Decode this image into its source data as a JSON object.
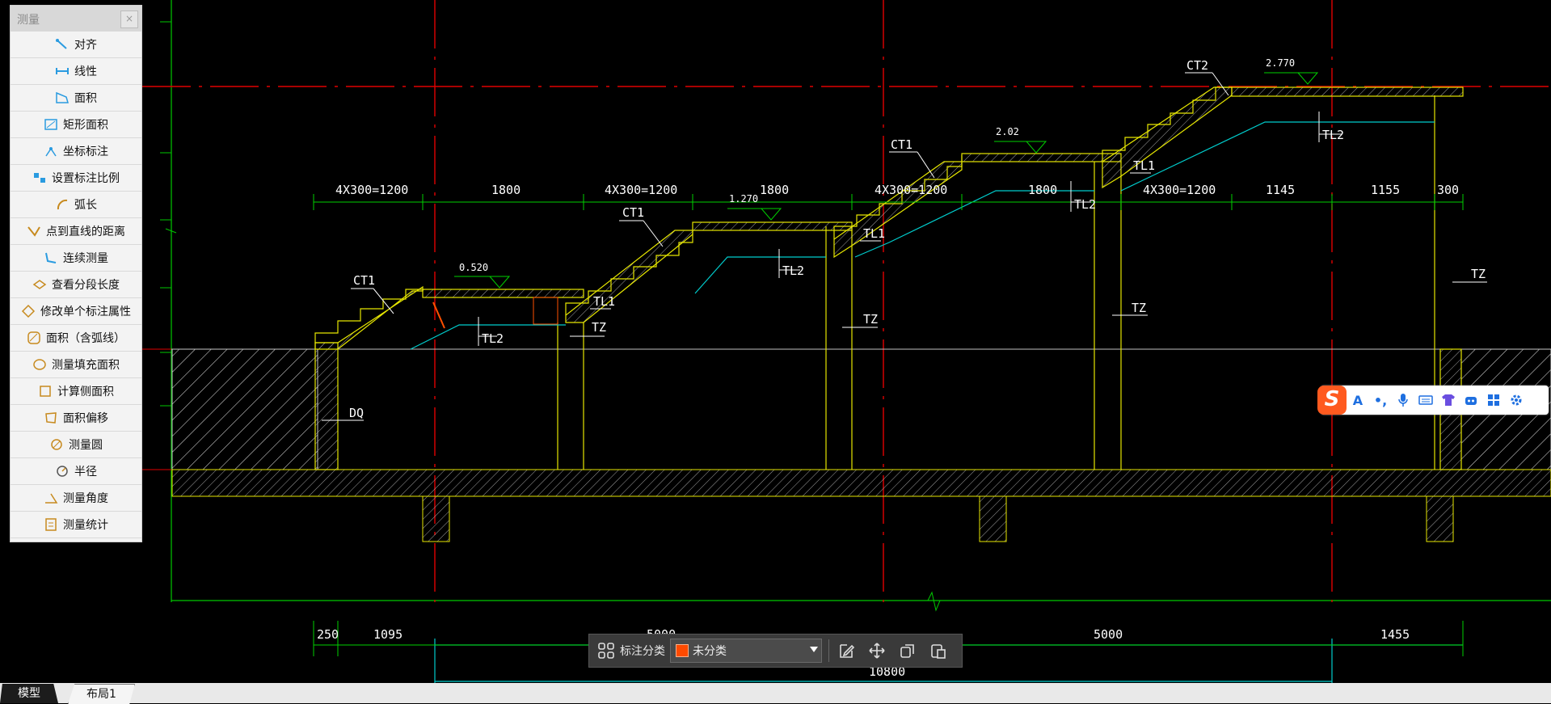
{
  "panel": {
    "title": "测量",
    "close_glyph": "×",
    "items": [
      {
        "label": "对齐",
        "icon": "aligned-dimension-icon"
      },
      {
        "label": "线性",
        "icon": "linear-dimension-icon"
      },
      {
        "label": "面积",
        "icon": "area-icon"
      },
      {
        "label": "矩形面积",
        "icon": "rectangle-area-icon"
      },
      {
        "label": "坐标标注",
        "icon": "coordinate-icon"
      },
      {
        "label": "设置标注比例",
        "icon": "scale-icon"
      },
      {
        "label": "弧长",
        "icon": "arc-length-icon"
      },
      {
        "label": "点到直线的距离",
        "icon": "point-line-distance-icon"
      },
      {
        "label": "连续测量",
        "icon": "continuous-measure-icon"
      },
      {
        "label": "查看分段长度",
        "icon": "segment-length-icon"
      },
      {
        "label": "修改单个标注属性",
        "icon": "edit-dimension-icon"
      },
      {
        "label": "面积（含弧线）",
        "icon": "arc-area-icon"
      },
      {
        "label": "测量填充面积",
        "icon": "hatch-area-icon"
      },
      {
        "label": "计算侧面积",
        "icon": "side-area-icon"
      },
      {
        "label": "面积偏移",
        "icon": "area-offset-icon"
      },
      {
        "label": "测量圆",
        "icon": "circle-icon"
      },
      {
        "label": "半径",
        "icon": "radius-icon"
      },
      {
        "label": "测量角度",
        "icon": "angle-icon"
      },
      {
        "label": "测量统计",
        "icon": "statistics-icon"
      }
    ]
  },
  "drawing": {
    "top_dims": [
      "4X300=1200",
      "1800",
      "4X300=1200",
      "1800",
      "4X300=1200",
      "1800",
      "4X300=1200",
      "1145",
      "1155",
      "300"
    ],
    "levels": [
      "0.520",
      "1.270",
      "2.02",
      "2.770"
    ],
    "labels": {
      "ct1_a": "CT1",
      "ct1_b": "CT1",
      "ct1_c": "CT1",
      "ct2": "CT2",
      "tl1_a": "TL1",
      "tl1_b": "TL1",
      "tl1_c": "TL1",
      "tl2_a": "TL2",
      "tl2_b": "TL2",
      "tl2_c": "TL2",
      "tl2_d": "TL2",
      "tz_a": "TZ",
      "tz_b": "TZ",
      "tz_c": "TZ",
      "tz_d": "TZ",
      "dq": "DQ"
    },
    "bottom_dims": [
      "250",
      "1095",
      "5000",
      "5000",
      "1455"
    ],
    "total_dim": "10800"
  },
  "toolbar": {
    "label": "标注分类",
    "selected": "未分类",
    "swatch_color": "#ff4a00"
  },
  "tabs": [
    "模型",
    "布局1"
  ],
  "ime": {
    "logo": "S",
    "font_glyph": "A"
  }
}
